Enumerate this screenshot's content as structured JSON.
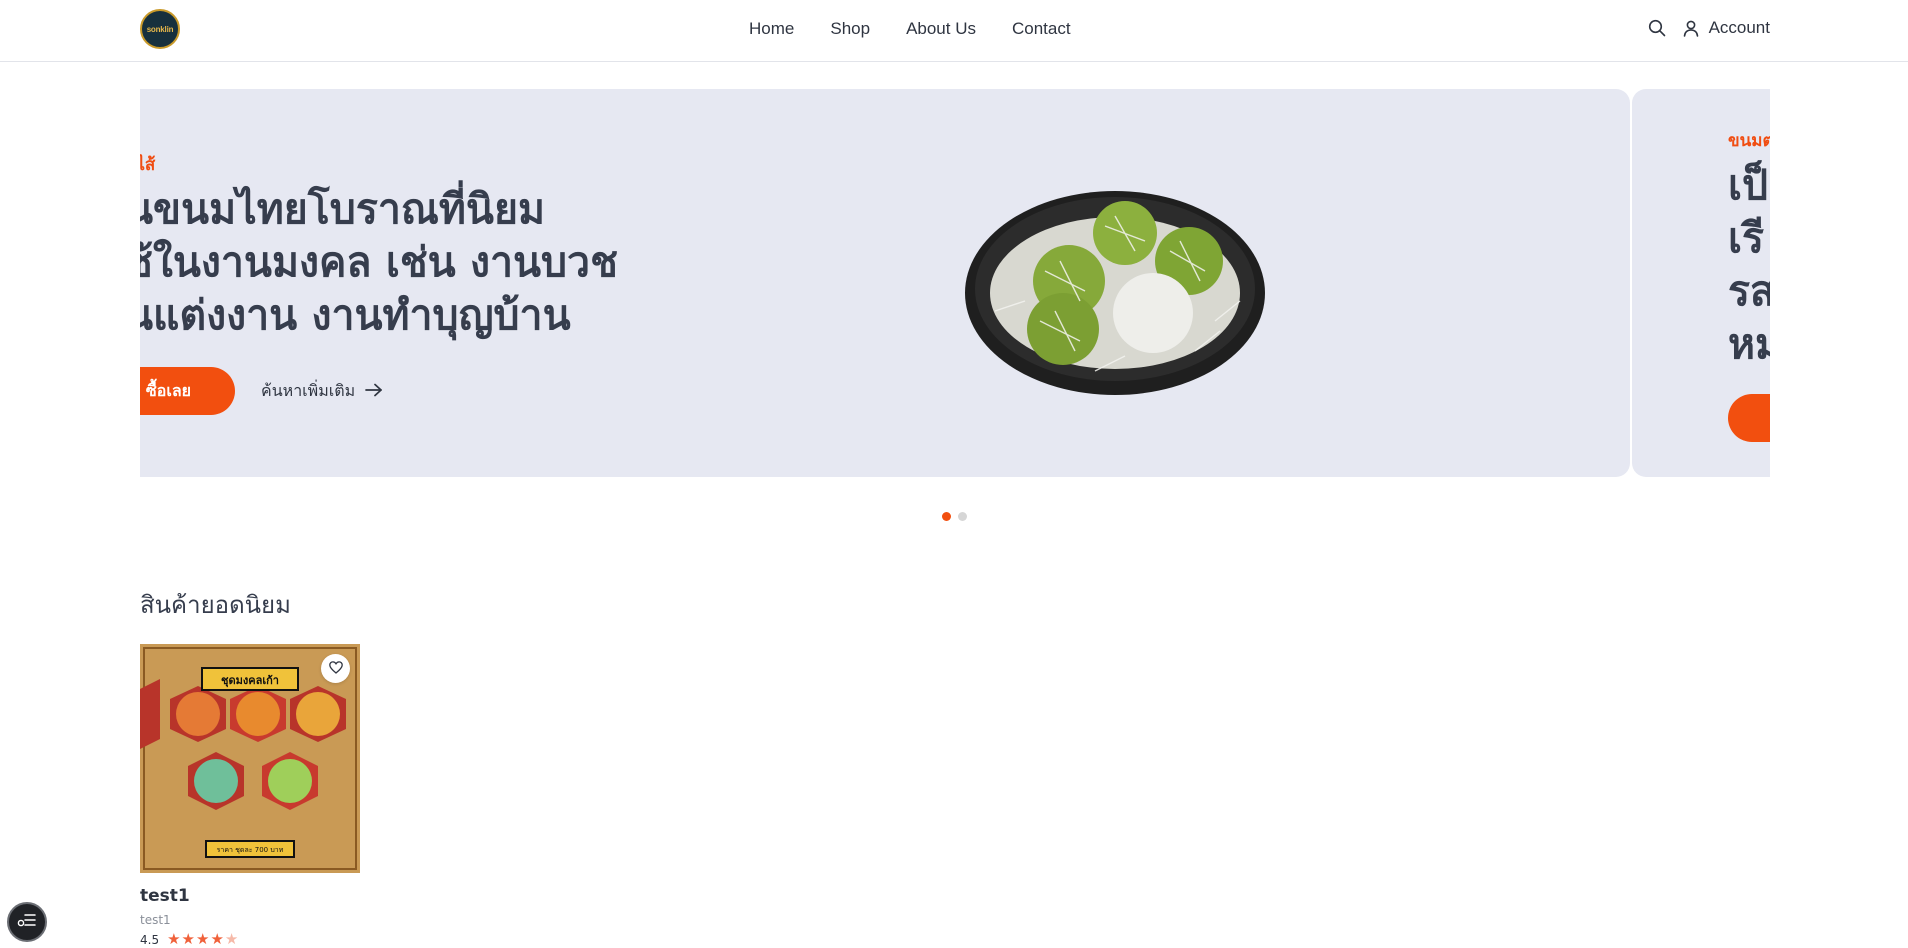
{
  "header": {
    "logo_text": "sonklin",
    "nav": [
      "Home",
      "Shop",
      "About Us",
      "Contact"
    ],
    "account_label": "Account"
  },
  "hero": {
    "slides": [
      {
        "eyebrow": "สไส้",
        "title_lines": [
          "นขนมไทยโบราณที่นิยม",
          "ช้ในงานมงคล เช่น งานบวช",
          "นแต่งงาน งานทำบุญบ้าน"
        ],
        "shop_button": "ซื้อเลย",
        "more_link": "ค้นหาเพิ่มเติม"
      },
      {
        "eyebrow": "ขนมต่",
        "title_lines": [
          "เป็",
          "เรี",
          "รส",
          "หม"
        ]
      }
    ],
    "active_slide": 1,
    "slide_count": 2
  },
  "popular": {
    "title": "สินค้ายอดนิยม",
    "products": [
      {
        "image_banner_top": "ชุดมงคลเก้า",
        "image_banner_bottom": "ราคา ชุดละ 700 บาท",
        "name": "test1",
        "subtitle": "test1",
        "rating": "4.5",
        "rating_value": 4.5,
        "rating_max": 5
      }
    ]
  },
  "colors": {
    "accent": "#f24f0f",
    "hero_bg": "#e6e8f2",
    "text": "#2f3541"
  }
}
